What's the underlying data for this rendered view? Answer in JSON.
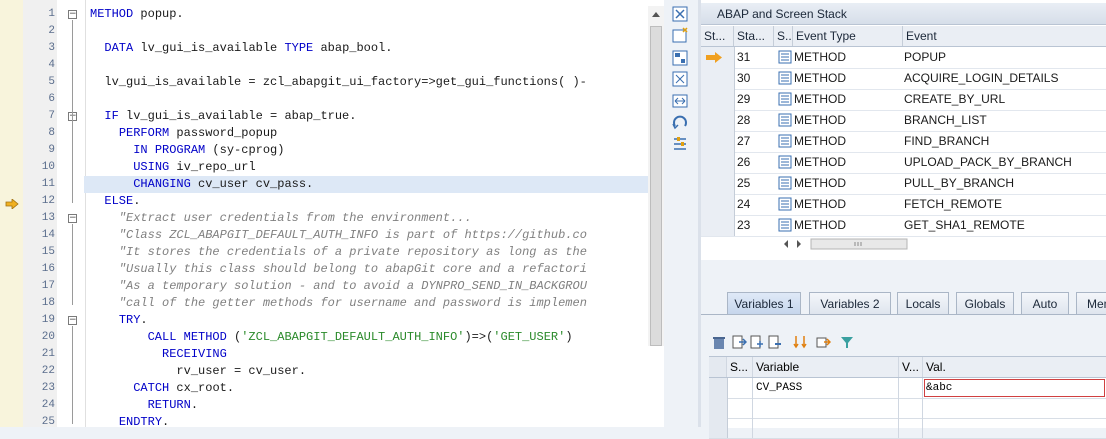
{
  "editor": {
    "lines": [
      {
        "n": "1",
        "html": "<span class='kw'>METHOD</span> popup."
      },
      {
        "n": "2",
        "html": ""
      },
      {
        "n": "3",
        "html": "  <span class='kw'>DATA</span> lv_gui_is_available <span class='kw'>TYPE</span> abap_bool."
      },
      {
        "n": "4",
        "html": ""
      },
      {
        "n": "5",
        "html": "  lv_gui_is_available = zcl_abapgit_ui_factory=>get_gui_functions( )-"
      },
      {
        "n": "6",
        "html": ""
      },
      {
        "n": "7",
        "html": "  <span class='kw'>IF</span> lv_gui_is_available = abap_true."
      },
      {
        "n": "8",
        "html": "    <span class='kw'>PERFORM</span> password_popup"
      },
      {
        "n": "9",
        "html": "      <span class='kw'>IN PROGRAM</span> (sy-cprog)"
      },
      {
        "n": "10",
        "html": "      <span class='kw'>USING</span> iv_repo_url"
      },
      {
        "n": "11",
        "html": "      <span class='kw'>CHANGING</span> cv_user cv_pass."
      },
      {
        "n": "12",
        "html": "  <span class='kw'>ELSE</span>."
      },
      {
        "n": "13",
        "html": "    <span class='cm'>\"Extract user credentials from the environment...</span>"
      },
      {
        "n": "14",
        "html": "    <span class='cm'>\"Class ZCL_ABAPGIT_DEFAULT_AUTH_INFO is part of https://github.co</span>"
      },
      {
        "n": "15",
        "html": "    <span class='cm'>\"It stores the credentials of a private repository as long as the</span>"
      },
      {
        "n": "16",
        "html": "    <span class='cm'>\"Usually this class should belong to abapGit core and a refactori</span>"
      },
      {
        "n": "17",
        "html": "    <span class='cm'>\"As a temporary solution - and to avoid a DYNPRO_SEND_IN_BACKGROU</span>"
      },
      {
        "n": "18",
        "html": "    <span class='cm'>\"call of the getter methods for username and password is implemen</span>"
      },
      {
        "n": "19",
        "html": "    <span class='kw'>TRY</span>."
      },
      {
        "n": "20",
        "html": "        <span class='kw'>CALL METHOD</span> (<span class='st'>'ZCL_ABAPGIT_DEFAULT_AUTH_INFO'</span>)=>(<span class='st'>'GET_USER'</span>)"
      },
      {
        "n": "21",
        "html": "          <span class='kw'>RECEIVING</span>"
      },
      {
        "n": "22",
        "html": "            rv_user = cv_user."
      },
      {
        "n": "23",
        "html": "      <span class='kw'>CATCH</span> cx_root."
      },
      {
        "n": "24",
        "html": "        <span class='kw'>RETURN</span>."
      },
      {
        "n": "25",
        "html": "    <span class='kw'>ENDTRY</span>."
      }
    ]
  },
  "stack": {
    "title": "ABAP and Screen Stack",
    "headers": [
      "St...",
      "Sta...",
      "S...",
      "Event Type",
      "Event"
    ],
    "rows": [
      {
        "level": "31",
        "type": "METHOD",
        "event": "POPUP",
        "current": true
      },
      {
        "level": "30",
        "type": "METHOD",
        "event": "ACQUIRE_LOGIN_DETAILS",
        "current": false
      },
      {
        "level": "29",
        "type": "METHOD",
        "event": "CREATE_BY_URL",
        "current": false
      },
      {
        "level": "28",
        "type": "METHOD",
        "event": "BRANCH_LIST",
        "current": false
      },
      {
        "level": "27",
        "type": "METHOD",
        "event": "FIND_BRANCH",
        "current": false
      },
      {
        "level": "26",
        "type": "METHOD",
        "event": "UPLOAD_PACK_BY_BRANCH",
        "current": false
      },
      {
        "level": "25",
        "type": "METHOD",
        "event": "PULL_BY_BRANCH",
        "current": false
      },
      {
        "level": "24",
        "type": "METHOD",
        "event": "FETCH_REMOTE",
        "current": false
      },
      {
        "level": "23",
        "type": "METHOD",
        "event": "GET_SHA1_REMOTE",
        "current": false
      }
    ]
  },
  "vars": {
    "tabs": [
      "Variables 1",
      "Variables 2",
      "Locals",
      "Globals",
      "Auto",
      "Mem"
    ],
    "headers": [
      "S...",
      "Variable",
      "V...",
      "Val."
    ],
    "rows": [
      {
        "name": "CV_PASS",
        "value": "&abc"
      },
      {
        "name": "",
        "value": ""
      },
      {
        "name": "",
        "value": ""
      }
    ]
  },
  "colors": {
    "accent": "#f0a020",
    "highlight": "#dde8f6"
  }
}
